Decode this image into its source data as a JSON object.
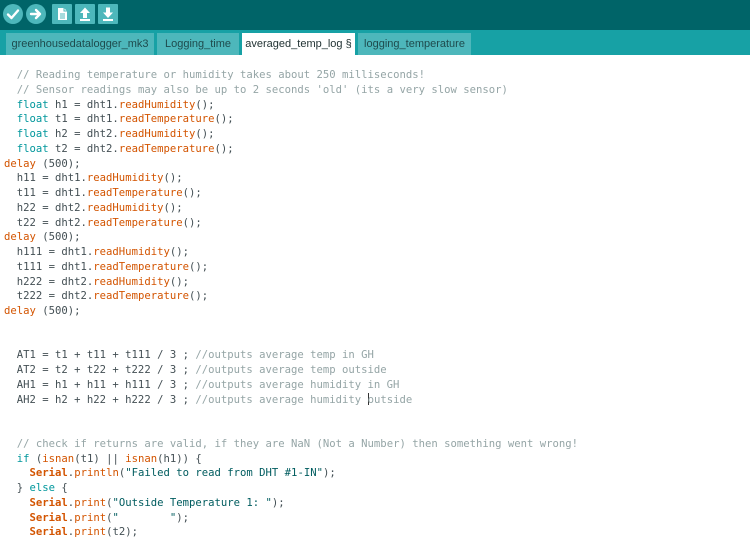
{
  "toolbar": {
    "buttons": [
      {
        "name": "verify-button",
        "icon": "check-icon"
      },
      {
        "name": "upload-button",
        "icon": "arrow-right-icon"
      },
      {
        "name": "new-button",
        "icon": "document-icon"
      },
      {
        "name": "open-button",
        "icon": "arrow-up-icon"
      },
      {
        "name": "save-button",
        "icon": "arrow-down-icon"
      }
    ]
  },
  "tabs": [
    {
      "label": "greenhousedatalogger_mk3",
      "active": false
    },
    {
      "label": "Logging_time",
      "active": false
    },
    {
      "label": "averaged_temp_log §",
      "active": true
    },
    {
      "label": "logging_temperature",
      "active": false
    }
  ],
  "colors": {
    "toolbar_bg": "#006468",
    "tabbar_bg": "#17a1a5",
    "tab_bg": "#4db7bb",
    "comment": "#95a5a6",
    "keyword": "#00979c",
    "function": "#d35400"
  },
  "code": {
    "lines": [
      [
        {
          "t": "  "
        },
        {
          "t": "// Reading temperature or humidity takes about 250 milliseconds!",
          "c": "cm"
        }
      ],
      [
        {
          "t": "  "
        },
        {
          "t": "// Sensor readings may also be up to 2 seconds 'old' (its a very slow sensor)",
          "c": "cm"
        }
      ],
      [
        {
          "t": "  "
        },
        {
          "t": "float",
          "c": "kw"
        },
        {
          "t": " h1 = dht1."
        },
        {
          "t": "readHumidity",
          "c": "fn"
        },
        {
          "t": "();"
        }
      ],
      [
        {
          "t": "  "
        },
        {
          "t": "float",
          "c": "kw"
        },
        {
          "t": " t1 = dht1."
        },
        {
          "t": "readTemperature",
          "c": "fn"
        },
        {
          "t": "();"
        }
      ],
      [
        {
          "t": "  "
        },
        {
          "t": "float",
          "c": "kw"
        },
        {
          "t": " h2 = dht2."
        },
        {
          "t": "readHumidity",
          "c": "fn"
        },
        {
          "t": "();"
        }
      ],
      [
        {
          "t": "  "
        },
        {
          "t": "float",
          "c": "kw"
        },
        {
          "t": " t2 = dht2."
        },
        {
          "t": "readTemperature",
          "c": "fn"
        },
        {
          "t": "();"
        }
      ],
      [
        {
          "t": "delay",
          "c": "fn"
        },
        {
          "t": " (500);"
        }
      ],
      [
        {
          "t": "  h11 = dht1."
        },
        {
          "t": "readHumidity",
          "c": "fn"
        },
        {
          "t": "();"
        }
      ],
      [
        {
          "t": "  t11 = dht1."
        },
        {
          "t": "readTemperature",
          "c": "fn"
        },
        {
          "t": "();"
        }
      ],
      [
        {
          "t": "  h22 = dht2."
        },
        {
          "t": "readHumidity",
          "c": "fn"
        },
        {
          "t": "();"
        }
      ],
      [
        {
          "t": "  t22 = dht2."
        },
        {
          "t": "readTemperature",
          "c": "fn"
        },
        {
          "t": "();"
        }
      ],
      [
        {
          "t": "delay",
          "c": "fn"
        },
        {
          "t": " (500);"
        }
      ],
      [
        {
          "t": "  h111 = dht1."
        },
        {
          "t": "readHumidity",
          "c": "fn"
        },
        {
          "t": "();"
        }
      ],
      [
        {
          "t": "  t111 = dht1."
        },
        {
          "t": "readTemperature",
          "c": "fn"
        },
        {
          "t": "();"
        }
      ],
      [
        {
          "t": "  h222 = dht2."
        },
        {
          "t": "readHumidity",
          "c": "fn"
        },
        {
          "t": "();"
        }
      ],
      [
        {
          "t": "  t222 = dht2."
        },
        {
          "t": "readTemperature",
          "c": "fn"
        },
        {
          "t": "();"
        }
      ],
      [
        {
          "t": "delay",
          "c": "fn"
        },
        {
          "t": " (500);"
        }
      ],
      [],
      [],
      [
        {
          "t": "  AT1 = t1 + t11 + t111 / 3 ; "
        },
        {
          "t": "//outputs average temp in GH",
          "c": "cm"
        }
      ],
      [
        {
          "t": "  AT2 = t2 + t22 + t222 / 3 ; "
        },
        {
          "t": "//outputs average temp outside",
          "c": "cm"
        }
      ],
      [
        {
          "t": "  AH1 = h1 + h11 + h111 / 3 ; "
        },
        {
          "t": "//outputs average humidity in GH",
          "c": "cm"
        }
      ],
      [
        {
          "t": "  AH2 = h2 + h22 + h222 / 3 ; "
        },
        {
          "t": "//outputs average humidity ",
          "c": "cm"
        },
        {
          "caret": true
        },
        {
          "t": "outside",
          "c": "cm"
        }
      ],
      [],
      [],
      [
        {
          "t": "  "
        },
        {
          "t": "// check if returns are valid, if they are NaN (Not a Number) then something went wrong!",
          "c": "cm"
        }
      ],
      [
        {
          "t": "  "
        },
        {
          "t": "if",
          "c": "kw"
        },
        {
          "t": " ("
        },
        {
          "t": "isnan",
          "c": "fn"
        },
        {
          "t": "(t1) || "
        },
        {
          "t": "isnan",
          "c": "fn"
        },
        {
          "t": "(h1)) {"
        }
      ],
      [
        {
          "t": "    "
        },
        {
          "t": "Serial",
          "c": "cls"
        },
        {
          "t": "."
        },
        {
          "t": "println",
          "c": "fn"
        },
        {
          "t": "("
        },
        {
          "t": "\"Failed to read from DHT #1-IN\"",
          "c": "str"
        },
        {
          "t": ");"
        }
      ],
      [
        {
          "t": "  } "
        },
        {
          "t": "else",
          "c": "kw"
        },
        {
          "t": " {"
        }
      ],
      [
        {
          "t": "    "
        },
        {
          "t": "Serial",
          "c": "cls"
        },
        {
          "t": "."
        },
        {
          "t": "print",
          "c": "fn"
        },
        {
          "t": "("
        },
        {
          "t": "\"Outside Temperature 1: \"",
          "c": "str"
        },
        {
          "t": ");"
        }
      ],
      [
        {
          "t": "    "
        },
        {
          "t": "Serial",
          "c": "cls"
        },
        {
          "t": "."
        },
        {
          "t": "print",
          "c": "fn"
        },
        {
          "t": "("
        },
        {
          "t": "\"        \"",
          "c": "str"
        },
        {
          "t": ");"
        }
      ],
      [
        {
          "t": "    "
        },
        {
          "t": "Serial",
          "c": "cls"
        },
        {
          "t": "."
        },
        {
          "t": "print",
          "c": "fn"
        },
        {
          "t": "(t2);"
        }
      ]
    ]
  }
}
